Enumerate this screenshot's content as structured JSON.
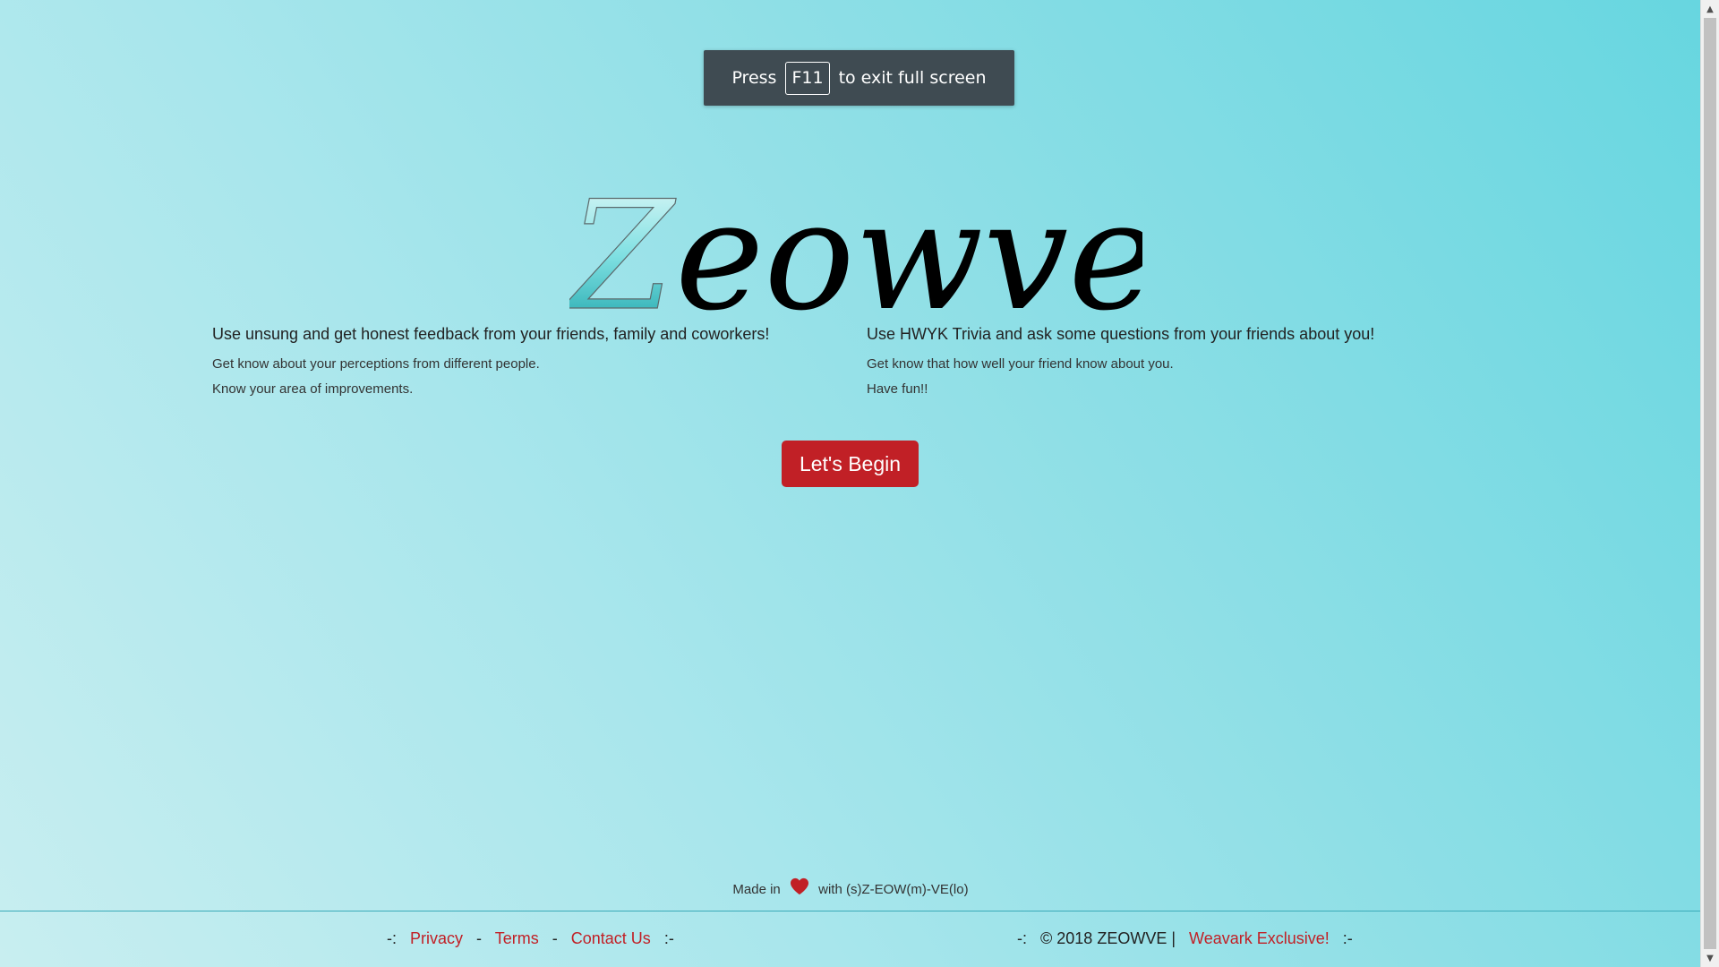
{
  "fullscreen_toast": {
    "press": "Press",
    "key": "F11",
    "suffix": "to exit full screen"
  },
  "logo": {
    "text": "Zeowve",
    "first_letter": "Z",
    "rest": "eowve"
  },
  "features": {
    "left": {
      "heading": "Use unsung and get honest feedback from your friends, family and coworkers!",
      "lines": [
        "Get know about your perceptions from different people.",
        "Know your area of improvements."
      ]
    },
    "right": {
      "heading": "Use HWYK Trivia and ask some questions from your friends about you!",
      "lines": [
        "Get know that how well your friend know about you.",
        "Have fun!!"
      ]
    }
  },
  "cta": {
    "label": "Let's Begin"
  },
  "made_in": {
    "prefix": "Made in",
    "icon": "heart-icon",
    "suffix": "with (s)Z-EOW(m)-VE(lo)"
  },
  "footer": {
    "left_open": "-:",
    "privacy": "Privacy",
    "sep1": "-",
    "terms": "Terms",
    "sep2": "-",
    "contact": "Contact Us",
    "left_close": ":-",
    "right_open": "-:",
    "copyright": "© 2018 ZEOWVE |",
    "exclusive": "Weavark Exclusive!",
    "right_close": ":-"
  },
  "colors": {
    "accent": "#c12026",
    "toast_bg": "#3f4b52",
    "logo_teal": "#2fc4c8"
  }
}
